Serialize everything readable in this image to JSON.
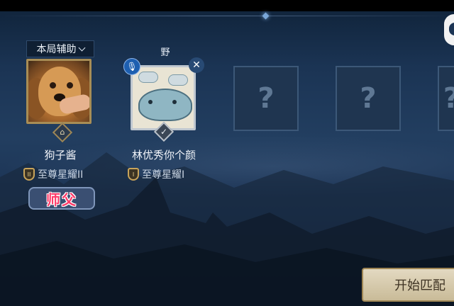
{
  "header": {
    "role_dropdown": "本局辅助"
  },
  "players": [
    {
      "name": "狗子酱",
      "rank": "至尊星耀II",
      "rank_tier": "II",
      "badge": "师父",
      "tag": ""
    },
    {
      "name": "林优秀你个颜",
      "rank": "至尊星耀I",
      "rank_tier": "I",
      "badge": "",
      "tag": "野"
    }
  ],
  "empty_slots": [
    {
      "placeholder": "?"
    },
    {
      "placeholder": "?"
    },
    {
      "placeholder": "?"
    }
  ],
  "start_button": {
    "label": "开始匹配"
  },
  "colors": {
    "gold_frame": "#a88d55",
    "silver_frame": "#bfc7d0",
    "master_text": "#ff3b6a",
    "start_button": "#e3d9c1"
  },
  "icons": {
    "mic": "microphone-icon",
    "close": "close-icon",
    "role_emblem": "diamond-emblem-icon",
    "ready": "check-icon"
  }
}
